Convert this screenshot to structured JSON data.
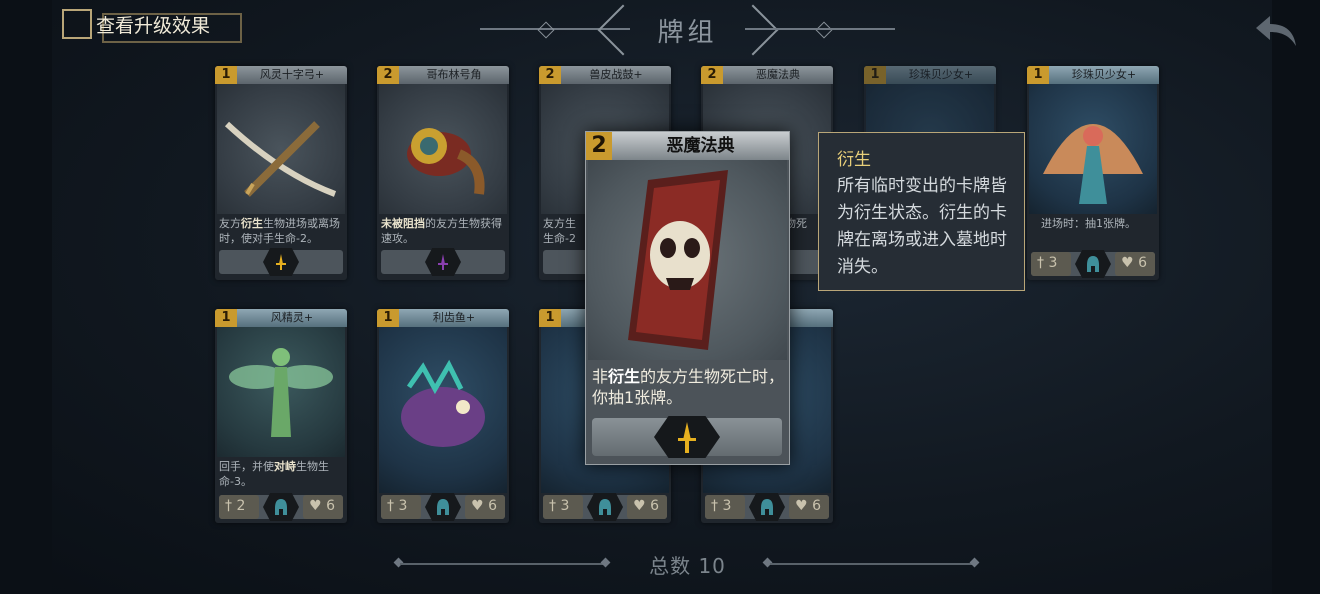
{
  "header": {
    "upgrade_toggle_label": "查看升级效果",
    "title": "牌组",
    "back_icon": "back-arrow-icon"
  },
  "cards": [
    {
      "cost": "1",
      "name": "风灵十字弓+",
      "text_pre": "友方",
      "text_bold": "衍生",
      "text_post": "生物进场或离场时，使对手生命-2。",
      "type": "dagger",
      "atk": "",
      "hp": ""
    },
    {
      "cost": "2",
      "name": "哥布林号角",
      "text_pre": "",
      "text_bold": "未被阻挡",
      "text_post": "的友方生物获得速攻。",
      "type": "dagger",
      "atk": "",
      "hp": ""
    },
    {
      "cost": "2",
      "name": "兽皮战鼓+",
      "text_pre": "友方生",
      "text_bold": "",
      "text_post": "生命-2",
      "type": "dagger",
      "atk": "",
      "hp": ""
    },
    {
      "cost": "2",
      "name": "恶魔法典",
      "text_pre": "",
      "text_bold": "",
      "text_post": "物死",
      "type": "dagger",
      "atk": "",
      "hp": ""
    },
    {
      "cost": "1",
      "name": "珍珠贝少女+",
      "text_pre": "",
      "text_bold": "",
      "text_post": "",
      "type": "helmet",
      "atk": "",
      "hp": ""
    },
    {
      "cost": "1",
      "name": "珍珠贝少女+",
      "text_pre": "",
      "text_bold": "",
      "text_post": "进场时：抽1张牌。",
      "type": "helmet",
      "atk": "3",
      "hp": "6"
    },
    {
      "cost": "1",
      "name": "风精灵+",
      "text_pre": "回手，并使",
      "text_bold": "对峙",
      "text_post": "生物生命-3。",
      "type": "helmet",
      "atk": "2",
      "hp": "6"
    },
    {
      "cost": "1",
      "name": "利齿鱼+",
      "text_pre": "",
      "text_bold": "",
      "text_post": "",
      "type": "helmet",
      "atk": "3",
      "hp": "6"
    },
    {
      "cost": "1",
      "name": "",
      "text_pre": "",
      "text_bold": "",
      "text_post": "",
      "type": "helmet",
      "atk": "3",
      "hp": "6"
    },
    {
      "cost": "",
      "name": "",
      "text_pre": "",
      "text_bold": "",
      "text_post": "",
      "type": "helmet",
      "atk": "3",
      "hp": "6"
    }
  ],
  "popup_card": {
    "cost": "2",
    "name": "恶魔法典",
    "text_1": "非",
    "text_bold": "衍生",
    "text_2": "的友方生物死亡时，你抽1张牌。",
    "type_icon": "dagger-icon"
  },
  "tooltip": {
    "title": "衍生",
    "body": "所有临时变出的卡牌皆为衍生状态。衍生的卡牌在离场或进入墓地时消失。"
  },
  "footer": {
    "total_label": "总数 10"
  },
  "colors": {
    "gold": "#c99a2e",
    "dagger": "#e6b020",
    "helmet": "#3f8f9a"
  }
}
